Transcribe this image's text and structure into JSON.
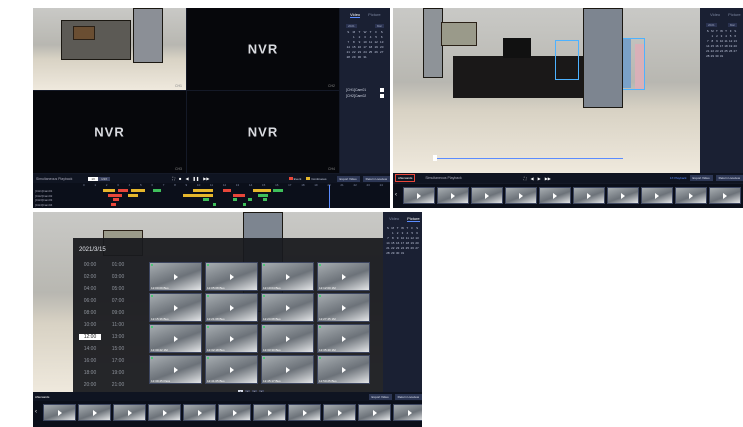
{
  "nvr_logo": "NVR",
  "panel1": {
    "channels": [
      {
        "label": "CH1"
      },
      {
        "label": "CH2"
      },
      {
        "label": "CH3"
      },
      {
        "label": "CH4"
      }
    ],
    "tabs": [
      "Video",
      "Picture"
    ],
    "calendar": {
      "buttons": [
        "2021",
        "Mar"
      ],
      "weekdays": [
        "S",
        "M",
        "T",
        "W",
        "T",
        "F",
        "S"
      ],
      "days": [
        "",
        "1",
        "2",
        "3",
        "4",
        "5",
        "6",
        "7",
        "8",
        "9",
        "10",
        "11",
        "12",
        "13",
        "14",
        "15",
        "16",
        "17",
        "18",
        "19",
        "20",
        "21",
        "22",
        "23",
        "24",
        "25",
        "26",
        "27",
        "28",
        "29",
        "30",
        "31",
        "",
        ""
      ]
    },
    "channel_list": [
      {
        "name": "[CH1]Cam01",
        "checked": true
      },
      {
        "name": "[CH2]Cam02",
        "checked": true
      }
    ],
    "bottom": {
      "left_text": "Simultaneous Playback",
      "toggle": [
        "1X",
        "1/2X"
      ],
      "legend": [
        "Event",
        "Continuous"
      ],
      "buttons": [
        "Export Video",
        "Return Liveview"
      ]
    },
    "timeline": {
      "rows": [
        "[CH1]Cam01",
        "[CH2]Cam02",
        "[CH3]Cam03",
        "[CH4]Cam04"
      ],
      "hours": [
        "0",
        "1",
        "2",
        "3",
        "4",
        "5",
        "6",
        "7",
        "8",
        "9",
        "10",
        "11",
        "12",
        "13",
        "14",
        "15",
        "16",
        "17",
        "18",
        "19",
        "20",
        "21",
        "22",
        "23",
        "24"
      ]
    }
  },
  "panel2": {
    "tabs": [
      "Video",
      "Picture"
    ],
    "calendar_buttons": [
      "2021",
      "Mar"
    ],
    "bottom": {
      "smart_btn": "Afterwards",
      "left_text": "Simultaneous Playback",
      "right_label": "1X Playback",
      "buttons": [
        "Export Video",
        "Return Liveview"
      ]
    }
  },
  "panel3": {
    "tabs": [
      "Video",
      "Picture"
    ],
    "date": "2021/3/15",
    "times_left": [
      "00:00",
      "02:00",
      "04:00",
      "06:00",
      "08:00",
      "10:00",
      "12:00",
      "14:00",
      "16:00",
      "18:00",
      "20:00",
      "22:00"
    ],
    "times_right": [
      "01:00",
      "03:00",
      "05:00",
      "07:00",
      "09:00",
      "11:00",
      "13:00",
      "15:00",
      "17:00",
      "19:00",
      "21:00",
      "23:00"
    ],
    "selected_time": "12:00",
    "thumbs": [
      [
        "12:00:09  Bus",
        "12:05:08  Bus",
        "12:10:04  Bus",
        "12:12:00  1M"
      ],
      [
        "12:15:36  Bus",
        "12:21:08  Bus",
        "12:24:08  Bus",
        "12:27:45  1M"
      ],
      [
        "12:30:42  1M",
        "12:32:18  Bus",
        "12:33:30  Bus",
        "12:35:40  1M"
      ],
      [
        "12:39:45  Pass",
        "12:41:05  Bus",
        "12:45:17  Bus",
        "12:50:25  Bus"
      ]
    ],
    "pages": [
      "1",
      "2",
      "3",
      "4"
    ],
    "bottom": {
      "smart_btn": "Afterwards",
      "buttons": [
        "Export Video",
        "Return Liveview"
      ]
    }
  },
  "colors": {
    "panel_bg": "#141927",
    "accent": "#5b8cff",
    "event": "#e8473a",
    "continuous": "#e6b72c",
    "motion": "#3fbf5b"
  }
}
